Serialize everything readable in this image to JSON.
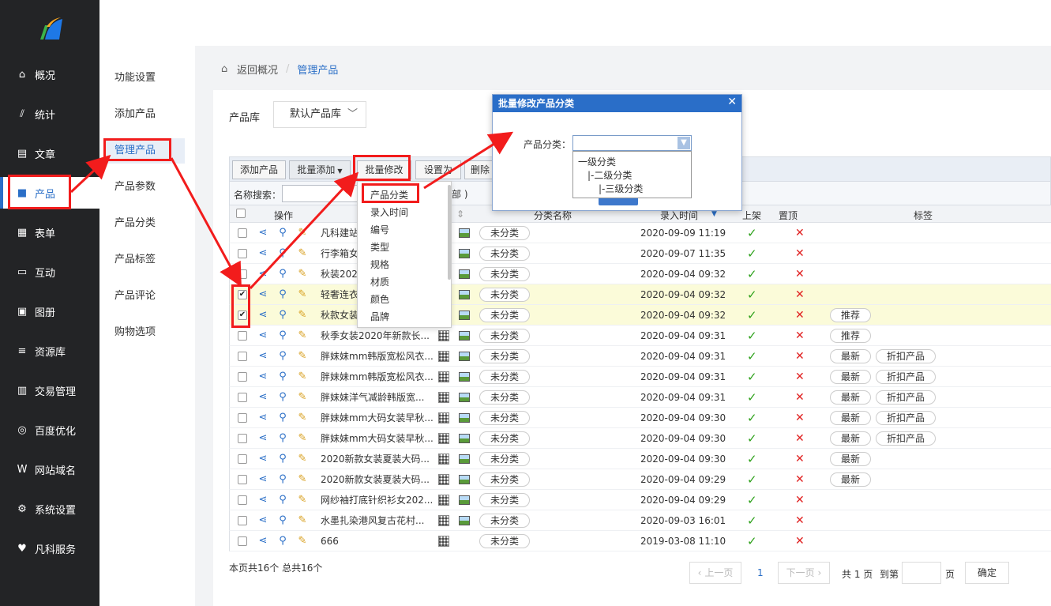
{
  "nav": {
    "items": [
      {
        "label": "概况",
        "icon": "home-icon"
      },
      {
        "label": "统计",
        "icon": "chart-icon"
      },
      {
        "label": "文章",
        "icon": "article-icon"
      },
      {
        "label": "产品",
        "icon": "product-icon"
      },
      {
        "label": "表单",
        "icon": "form-icon"
      },
      {
        "label": "互动",
        "icon": "chat-icon"
      },
      {
        "label": "图册",
        "icon": "album-icon"
      },
      {
        "label": "资源库",
        "icon": "database-icon"
      },
      {
        "label": "交易管理",
        "icon": "trade-icon"
      },
      {
        "label": "百度优化",
        "icon": "seo-icon"
      },
      {
        "label": "网站域名",
        "icon": "domain-icon"
      },
      {
        "label": "系统设置",
        "icon": "gear-icon"
      },
      {
        "label": "凡科服务",
        "icon": "heart-icon"
      }
    ]
  },
  "subnav": {
    "items": [
      "功能设置",
      "添加产品",
      "管理产品",
      "产品参数",
      "产品分类",
      "产品标签",
      "产品评论",
      "购物选项"
    ]
  },
  "breadcrumb": {
    "back": "返回概况",
    "separator": "/",
    "current": "管理产品"
  },
  "library": {
    "label": "产品库",
    "value": "默认产品库"
  },
  "toolbar": {
    "add": "添加产品",
    "batch_add": "批量添加",
    "batch_edit": "批量修改",
    "set_as": "设置为",
    "delete": "删除"
  },
  "search": {
    "label": "名称搜索：",
    "part": "部 )"
  },
  "table": {
    "headers": {
      "op": "操作",
      "category": "分类名称",
      "time": "录入时间",
      "on_shelf": "上架",
      "top": "置顶",
      "tags": "标签"
    },
    "rows": [
      {
        "name": "凡科建站",
        "category": "未分类",
        "time": "2020-09-09 11:19",
        "checked": false,
        "tags": []
      },
      {
        "name": "行李箱女",
        "category": "未分类",
        "time": "2020-09-07 11:35",
        "checked": false,
        "tags": []
      },
      {
        "name": "秋装2020",
        "category": "未分类",
        "time": "2020-09-04 09:32",
        "checked": false,
        "tags": []
      },
      {
        "name": "轻奢连衣",
        "category": "未分类",
        "time": "2020-09-04 09:32",
        "checked": true,
        "tags": []
      },
      {
        "name": "秋款女装",
        "category": "未分类",
        "time": "2020-09-04 09:32",
        "checked": true,
        "tags": [
          "推荐"
        ]
      },
      {
        "name": "秋季女装2020年新款长...",
        "category": "未分类",
        "time": "2020-09-04 09:31",
        "checked": false,
        "tags": [
          "推荐"
        ]
      },
      {
        "name": "胖妹妹mm韩版宽松风衣...",
        "category": "未分类",
        "time": "2020-09-04 09:31",
        "checked": false,
        "tags": [
          "最新",
          "折扣产品"
        ]
      },
      {
        "name": "胖妹妹mm韩版宽松风衣...",
        "category": "未分类",
        "time": "2020-09-04 09:31",
        "checked": false,
        "tags": [
          "最新",
          "折扣产品"
        ]
      },
      {
        "name": "胖妹妹洋气减龄韩版宽...",
        "category": "未分类",
        "time": "2020-09-04 09:31",
        "checked": false,
        "tags": [
          "最新",
          "折扣产品"
        ]
      },
      {
        "name": "胖妹妹mm大码女装早秋...",
        "category": "未分类",
        "time": "2020-09-04 09:30",
        "checked": false,
        "tags": [
          "最新",
          "折扣产品"
        ]
      },
      {
        "name": "胖妹妹mm大码女装早秋...",
        "category": "未分类",
        "time": "2020-09-04 09:30",
        "checked": false,
        "tags": [
          "最新",
          "折扣产品"
        ]
      },
      {
        "name": "2020新款女装夏装大码...",
        "category": "未分类",
        "time": "2020-09-04 09:30",
        "checked": false,
        "tags": [
          "最新"
        ]
      },
      {
        "name": "2020新款女装夏装大码...",
        "category": "未分类",
        "time": "2020-09-04 09:29",
        "checked": false,
        "tags": [
          "最新"
        ]
      },
      {
        "name": "网纱袖打底针织衫女202...",
        "category": "未分类",
        "time": "2020-09-04 09:29",
        "checked": false,
        "tags": []
      },
      {
        "name": "水墨扎染港风复古花村...",
        "category": "未分类",
        "time": "2020-09-03 16:01",
        "checked": false,
        "tags": []
      },
      {
        "name": "666",
        "category": "未分类",
        "time": "2019-03-08 11:10",
        "checked": false,
        "tags": []
      }
    ]
  },
  "footer": {
    "summary": "本页共16个 总共16个",
    "prev": "上一页",
    "page": "1",
    "next": "下一页",
    "total": "共 1 页",
    "goto": "到第",
    "page_unit": "页",
    "confirm": "确定"
  },
  "dropdown": {
    "items": [
      "产品分类",
      "录入时间",
      "编号",
      "类型",
      "规格",
      "材质",
      "颜色",
      "品牌"
    ]
  },
  "modal": {
    "title": "批量修改产品分类",
    "label": "产品分类：",
    "options": [
      "一级分类",
      "|-二级分类",
      "|-三级分类"
    ]
  },
  "colors": {
    "accent": "#2b6fc7",
    "highlight": "#f21c1c",
    "sidebar": "#232426"
  }
}
